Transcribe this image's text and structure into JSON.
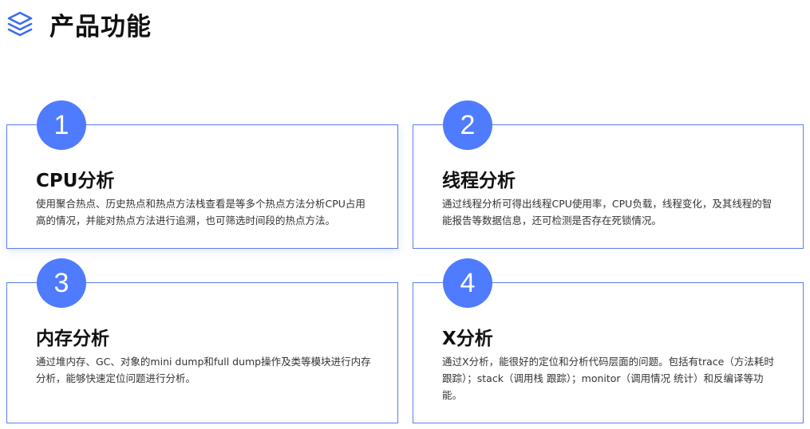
{
  "header": {
    "title": "产品功能",
    "icon": "layers-icon"
  },
  "colors": {
    "accent": "#4f7bff",
    "card_border": "#5b7cf5",
    "title_text": "#111111",
    "body_text": "#333333"
  },
  "cards": [
    {
      "number": "1",
      "title": "CPU分析",
      "desc": "使用聚合热点、历史热点和热点方法栈查看是等多个热点方法分析CPU占用高的情况，并能对热点方法进行追溯，也可筛选时间段的热点方法。"
    },
    {
      "number": "2",
      "title": "线程分析",
      "desc": "通过线程分析可得出线程CPU使用率，CPU负载，线程变化，及其线程的智能报告等数据信息，还可检测是否存在死锁情况。"
    },
    {
      "number": "3",
      "title": "内存分析",
      "desc": "通过堆内存、GC、对象的mini dump和full dump操作及类等模块进行内存分析，能够快速定位问题进行分析。"
    },
    {
      "number": "4",
      "title": "X分析",
      "desc": "通过X分析，能很好的定位和分析代码层面的问题。包括有trace（方法耗时跟踪）；stack（调用栈 跟踪）；monitor（调用情况 统计）和反编译等功能。"
    }
  ]
}
